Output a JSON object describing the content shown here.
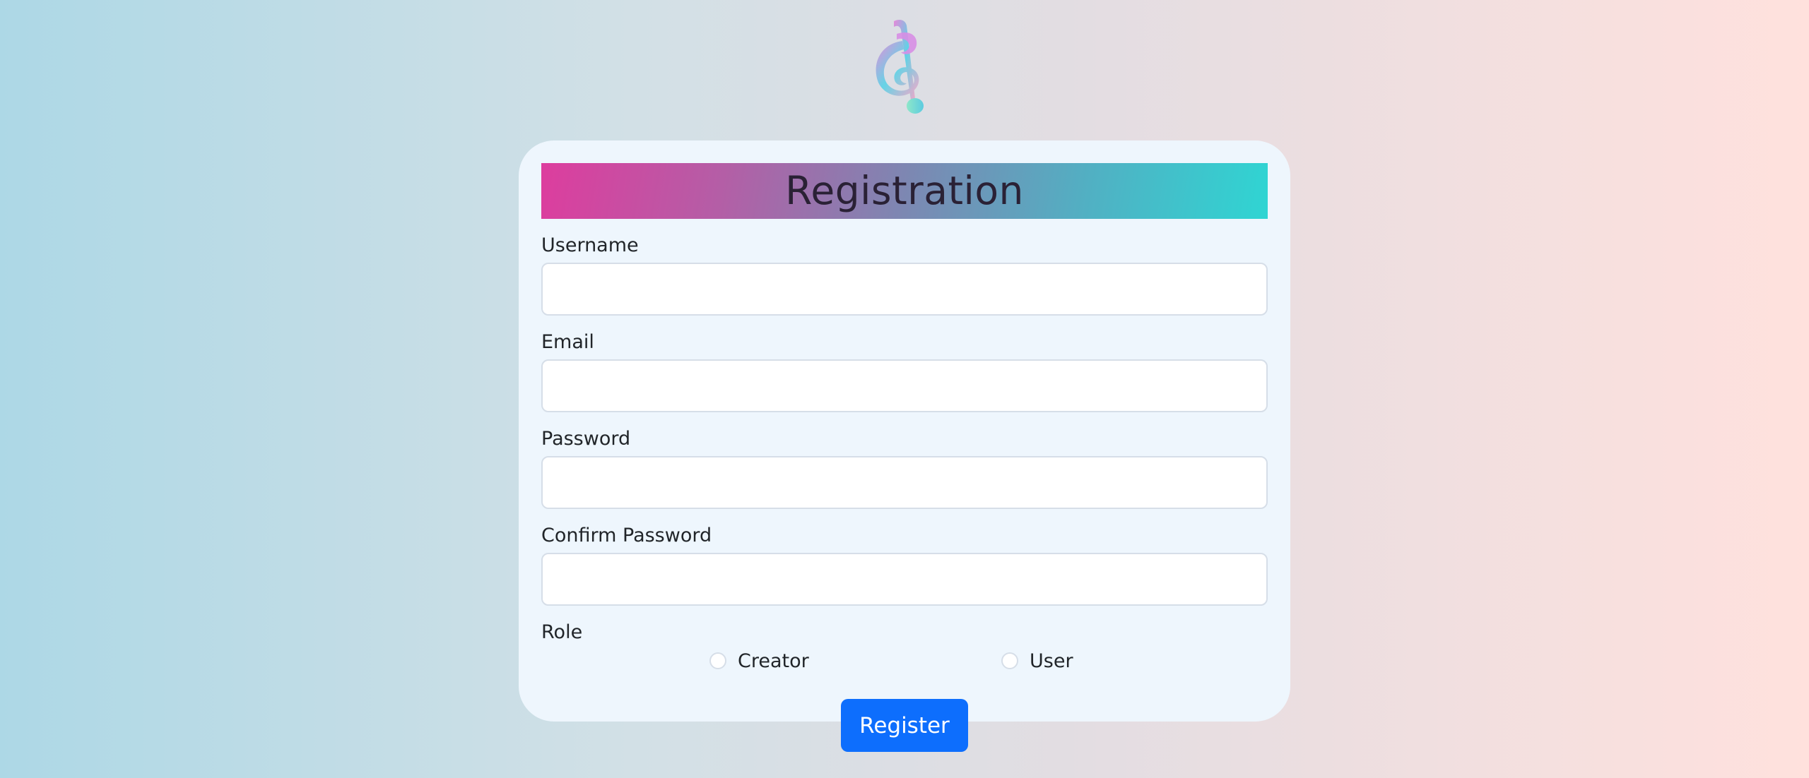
{
  "logo": {
    "icon": "music-note-icon"
  },
  "form": {
    "title": "Registration",
    "fields": {
      "username": {
        "label": "Username",
        "value": "",
        "placeholder": ""
      },
      "email": {
        "label": "Email",
        "value": "",
        "placeholder": ""
      },
      "password": {
        "label": "Password",
        "value": "",
        "placeholder": ""
      },
      "confirm_password": {
        "label": "Confirm Password",
        "value": "",
        "placeholder": ""
      }
    },
    "role": {
      "label": "Role",
      "options": [
        "Creator",
        "User"
      ],
      "selected": null
    },
    "submit_label": "Register"
  },
  "colors": {
    "accent_button": "#0d6efd",
    "title_gradient_start": "#dd3d9e",
    "title_gradient_end": "#2fd5d3",
    "card_background": "#eef6fd"
  }
}
